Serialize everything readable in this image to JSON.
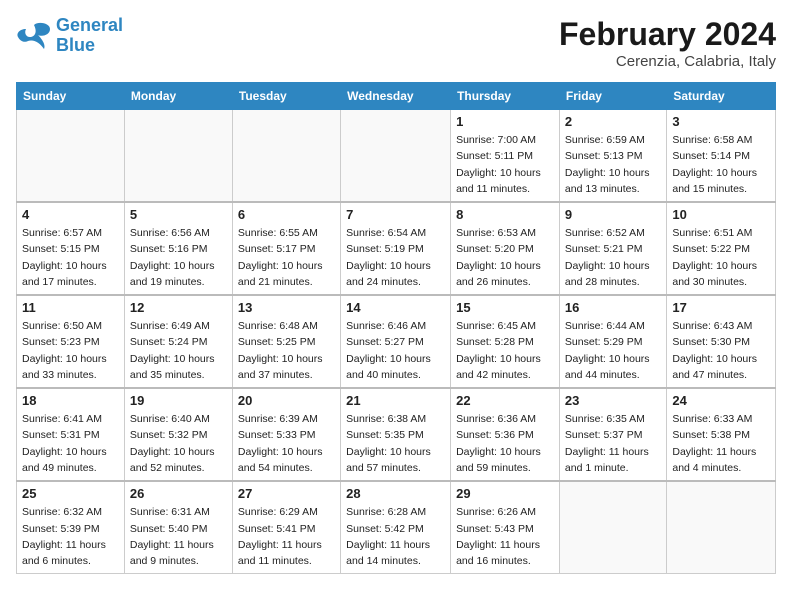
{
  "logo": {
    "text_general": "General",
    "text_blue": "Blue"
  },
  "header": {
    "month": "February 2024",
    "location": "Cerenzia, Calabria, Italy"
  },
  "columns": [
    "Sunday",
    "Monday",
    "Tuesday",
    "Wednesday",
    "Thursday",
    "Friday",
    "Saturday"
  ],
  "weeks": [
    [
      {
        "day": "",
        "info": ""
      },
      {
        "day": "",
        "info": ""
      },
      {
        "day": "",
        "info": ""
      },
      {
        "day": "",
        "info": ""
      },
      {
        "day": "1",
        "info": "Sunrise: 7:00 AM\nSunset: 5:11 PM\nDaylight: 10 hours\nand 11 minutes."
      },
      {
        "day": "2",
        "info": "Sunrise: 6:59 AM\nSunset: 5:13 PM\nDaylight: 10 hours\nand 13 minutes."
      },
      {
        "day": "3",
        "info": "Sunrise: 6:58 AM\nSunset: 5:14 PM\nDaylight: 10 hours\nand 15 minutes."
      }
    ],
    [
      {
        "day": "4",
        "info": "Sunrise: 6:57 AM\nSunset: 5:15 PM\nDaylight: 10 hours\nand 17 minutes."
      },
      {
        "day": "5",
        "info": "Sunrise: 6:56 AM\nSunset: 5:16 PM\nDaylight: 10 hours\nand 19 minutes."
      },
      {
        "day": "6",
        "info": "Sunrise: 6:55 AM\nSunset: 5:17 PM\nDaylight: 10 hours\nand 21 minutes."
      },
      {
        "day": "7",
        "info": "Sunrise: 6:54 AM\nSunset: 5:19 PM\nDaylight: 10 hours\nand 24 minutes."
      },
      {
        "day": "8",
        "info": "Sunrise: 6:53 AM\nSunset: 5:20 PM\nDaylight: 10 hours\nand 26 minutes."
      },
      {
        "day": "9",
        "info": "Sunrise: 6:52 AM\nSunset: 5:21 PM\nDaylight: 10 hours\nand 28 minutes."
      },
      {
        "day": "10",
        "info": "Sunrise: 6:51 AM\nSunset: 5:22 PM\nDaylight: 10 hours\nand 30 minutes."
      }
    ],
    [
      {
        "day": "11",
        "info": "Sunrise: 6:50 AM\nSunset: 5:23 PM\nDaylight: 10 hours\nand 33 minutes."
      },
      {
        "day": "12",
        "info": "Sunrise: 6:49 AM\nSunset: 5:24 PM\nDaylight: 10 hours\nand 35 minutes."
      },
      {
        "day": "13",
        "info": "Sunrise: 6:48 AM\nSunset: 5:25 PM\nDaylight: 10 hours\nand 37 minutes."
      },
      {
        "day": "14",
        "info": "Sunrise: 6:46 AM\nSunset: 5:27 PM\nDaylight: 10 hours\nand 40 minutes."
      },
      {
        "day": "15",
        "info": "Sunrise: 6:45 AM\nSunset: 5:28 PM\nDaylight: 10 hours\nand 42 minutes."
      },
      {
        "day": "16",
        "info": "Sunrise: 6:44 AM\nSunset: 5:29 PM\nDaylight: 10 hours\nand 44 minutes."
      },
      {
        "day": "17",
        "info": "Sunrise: 6:43 AM\nSunset: 5:30 PM\nDaylight: 10 hours\nand 47 minutes."
      }
    ],
    [
      {
        "day": "18",
        "info": "Sunrise: 6:41 AM\nSunset: 5:31 PM\nDaylight: 10 hours\nand 49 minutes."
      },
      {
        "day": "19",
        "info": "Sunrise: 6:40 AM\nSunset: 5:32 PM\nDaylight: 10 hours\nand 52 minutes."
      },
      {
        "day": "20",
        "info": "Sunrise: 6:39 AM\nSunset: 5:33 PM\nDaylight: 10 hours\nand 54 minutes."
      },
      {
        "day": "21",
        "info": "Sunrise: 6:38 AM\nSunset: 5:35 PM\nDaylight: 10 hours\nand 57 minutes."
      },
      {
        "day": "22",
        "info": "Sunrise: 6:36 AM\nSunset: 5:36 PM\nDaylight: 10 hours\nand 59 minutes."
      },
      {
        "day": "23",
        "info": "Sunrise: 6:35 AM\nSunset: 5:37 PM\nDaylight: 11 hours\nand 1 minute."
      },
      {
        "day": "24",
        "info": "Sunrise: 6:33 AM\nSunset: 5:38 PM\nDaylight: 11 hours\nand 4 minutes."
      }
    ],
    [
      {
        "day": "25",
        "info": "Sunrise: 6:32 AM\nSunset: 5:39 PM\nDaylight: 11 hours\nand 6 minutes."
      },
      {
        "day": "26",
        "info": "Sunrise: 6:31 AM\nSunset: 5:40 PM\nDaylight: 11 hours\nand 9 minutes."
      },
      {
        "day": "27",
        "info": "Sunrise: 6:29 AM\nSunset: 5:41 PM\nDaylight: 11 hours\nand 11 minutes."
      },
      {
        "day": "28",
        "info": "Sunrise: 6:28 AM\nSunset: 5:42 PM\nDaylight: 11 hours\nand 14 minutes."
      },
      {
        "day": "29",
        "info": "Sunrise: 6:26 AM\nSunset: 5:43 PM\nDaylight: 11 hours\nand 16 minutes."
      },
      {
        "day": "",
        "info": ""
      },
      {
        "day": "",
        "info": ""
      }
    ]
  ]
}
